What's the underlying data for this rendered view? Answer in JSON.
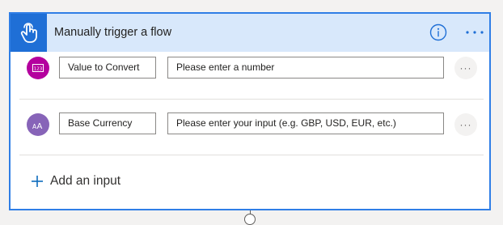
{
  "header": {
    "title": "Manually trigger a flow",
    "trigger_icon": "hand-touch-icon",
    "info_icon": "info-icon",
    "more_icon": "more-horizontal-icon",
    "color": "#1f6fd6",
    "background": "#d8e8fb"
  },
  "inputs": [
    {
      "type_icon": "number-icon",
      "icon_color": "#b4009e",
      "name": "Value to Convert",
      "value": "Please enter a number",
      "more_label": "···"
    },
    {
      "type_icon": "text-icon",
      "icon_color": "#8764b8",
      "name": "Base Currency",
      "value": "Please enter your input (e.g. GBP, USD, EUR, etc.)",
      "more_label": "···"
    }
  ],
  "add_input": {
    "label": "Add an input",
    "accent": "#0f6cbd"
  }
}
